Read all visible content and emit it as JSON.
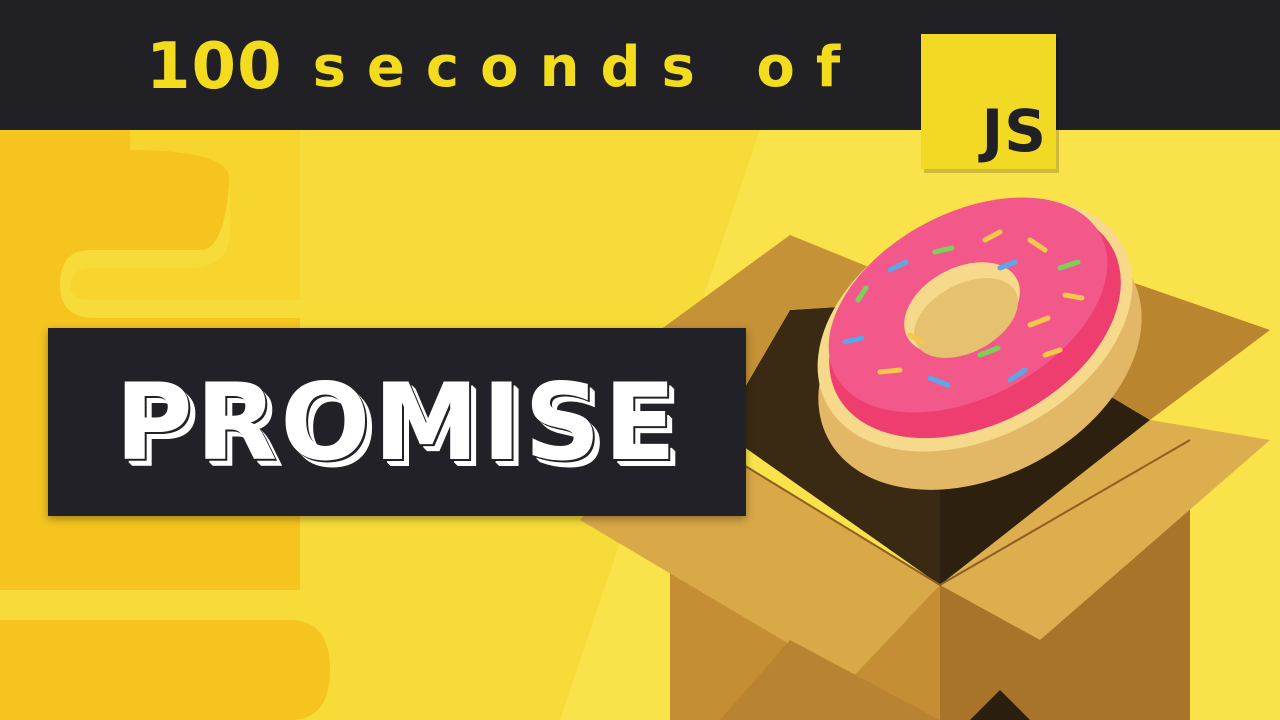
{
  "header": {
    "series_number": "100",
    "series_text": "seconds of",
    "badge_label": "JS"
  },
  "topic": {
    "title": "PROMISE"
  },
  "colors": {
    "background_yellow": "#f7db38",
    "dark_bar": "#212024",
    "accent_yellow": "#f3db1d",
    "donut_frosting": "#ec3a6a",
    "donut_dough": "#e6c170",
    "box_cardboard": "#c9953a"
  },
  "illustration": {
    "subject": "donut-in-cardboard-box"
  }
}
